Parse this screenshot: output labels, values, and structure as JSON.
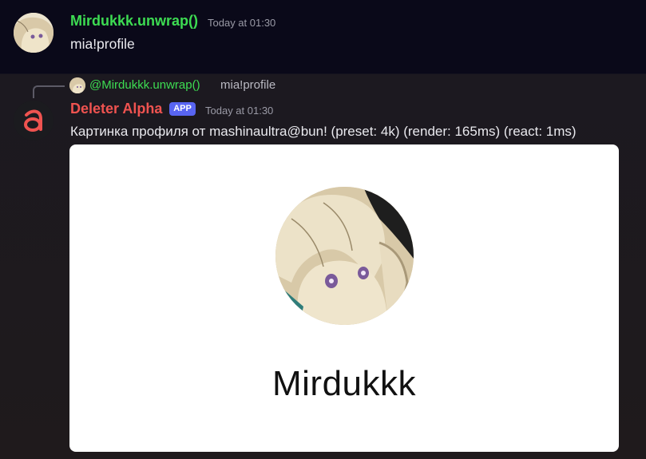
{
  "message1": {
    "username": "Mirdukkk.unwrap()",
    "timestamp": "Today at 01:30",
    "content": "mia!profile"
  },
  "message2": {
    "reply": {
      "username": "@Mirdukkk.unwrap()",
      "content": "mia!profile"
    },
    "username": "Deleter Alpha",
    "badge": "APP",
    "timestamp": "Today at 01:30",
    "content": "Картинка профиля от mashinaultra@bun! (preset: 4k) (render: 165ms) (react: 1ms)",
    "embed": {
      "profile_name": "Mirdukkk"
    }
  },
  "colors": {
    "username_green": "#3ddc52",
    "bot_red": "#ef5350",
    "app_badge": "#5865f2"
  }
}
